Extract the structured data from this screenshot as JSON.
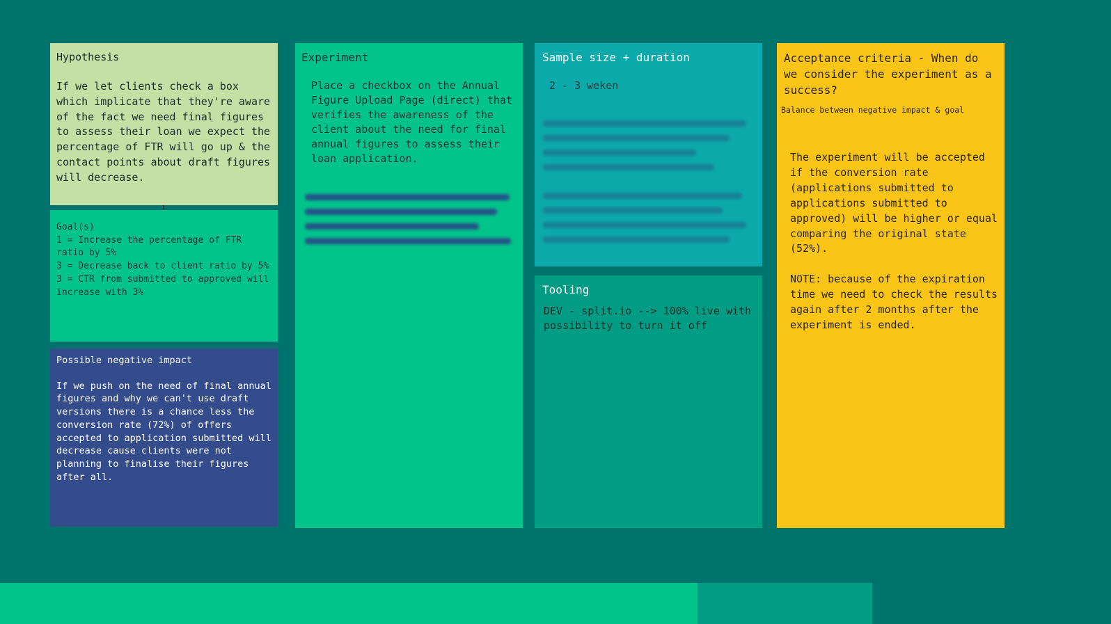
{
  "hypothesis": {
    "title": "Hypothesis",
    "body": "If we let clients check a box which implicate that they're aware of the fact we need final figures to assess their loan we expect the percentage of FTR will go up & the contact points about draft figures will decrease."
  },
  "goals": {
    "title": "Goal(s)",
    "body": "1 = Increase the percentage of FTR ratio by 5%\n3 = Decrease back to client ratio by 5%\n3 = CTR from submitted to approved will increase with 3%"
  },
  "negative_impact": {
    "title": "Possible negative impact",
    "body": "If we push on the need of final annual figures and why we can't use draft versions there is a chance less the conversion rate (72%) of offers accepted to application submitted will decrease cause clients were not planning to finalise their figures after all."
  },
  "experiment": {
    "title": "Experiment",
    "body": "Place a checkbox on the Annual Figure Upload Page (direct) that verifies the awareness of the client about the need for final annual figures to assess their loan application."
  },
  "sample": {
    "title": "Sample size + duration",
    "body": "2 - 3 weken"
  },
  "tooling": {
    "title": "Tooling",
    "body": "DEV - split.io --> 100% live with possibility to turn it off"
  },
  "acceptance": {
    "title": "Acceptance criteria - When do we consider the experiment as a success?",
    "subtitle": "Balance between negative impact & goal",
    "body": "The experiment will be accepted if the conversion rate (applications submitted to applications submitted to approved) will be higher or equal comparing the original state (52%).\n\nNOTE: because of the expiration time we need to check the results again after 2 months after the experiment is ended."
  },
  "colors": {
    "background": "#00746c",
    "hypothesis": "#c4e0a5",
    "green": "#02c48b",
    "navy": "#344c8c",
    "teal": "#0ca9ab",
    "dark_green": "#009c84",
    "yellow": "#fac516"
  }
}
